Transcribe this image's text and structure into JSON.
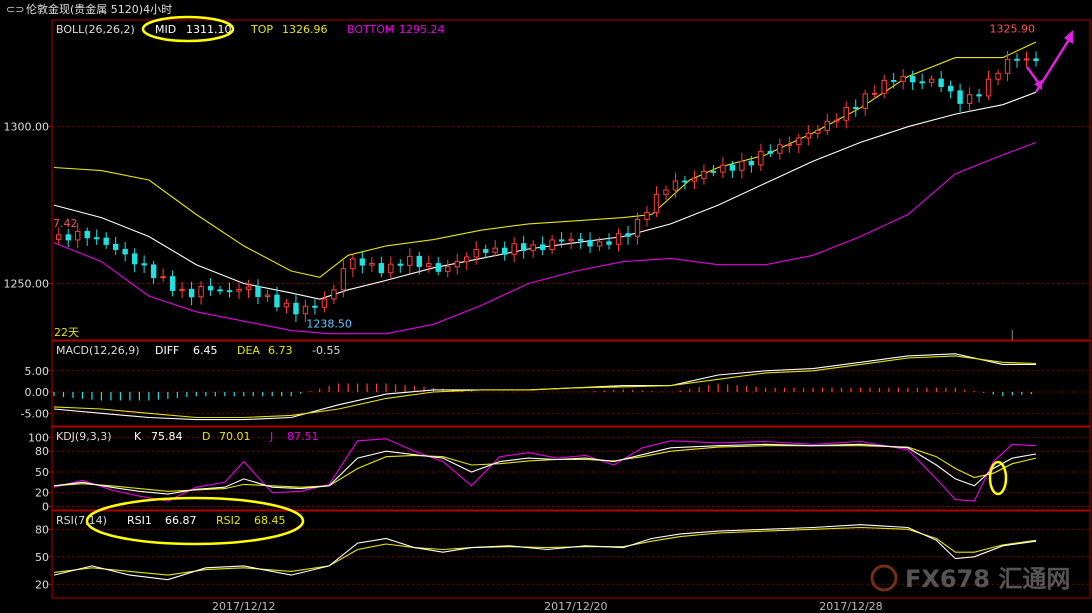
{
  "window": {
    "title": "伦敦金现(贵金属 5120)4小时"
  },
  "chart_data": {
    "type": "candlestick",
    "period": "22天",
    "x_tick_labels": [
      "2017/12/12",
      "2017/12/20",
      "2017/12/28"
    ],
    "price_panel": {
      "indicator": "BOLL(26,26,2)",
      "legend": [
        {
          "label": "MID",
          "value": "1311.10",
          "color": "#ffffff"
        },
        {
          "label": "TOP",
          "value": "1326.96",
          "color": "#e6e600"
        },
        {
          "label": "BOTTOM",
          "value": "1295.24",
          "color": "#e600e6"
        }
      ],
      "y_ticks": [
        "1300.00",
        "1250.00"
      ],
      "y_tick_values": [
        1300,
        1250
      ],
      "ylim": [
        1232,
        1334
      ],
      "annotations": {
        "high": "1325.90",
        "low": "1238.50",
        "left_value": "7.42"
      },
      "close_path": [
        [
          0,
          1264
        ],
        [
          6,
          1266
        ],
        [
          12,
          1262
        ],
        [
          18,
          1256
        ],
        [
          24,
          1250
        ],
        [
          28,
          1246
        ],
        [
          32,
          1249
        ],
        [
          36,
          1247
        ],
        [
          40,
          1249
        ],
        [
          44,
          1246
        ],
        [
          48,
          1243
        ],
        [
          52,
          1241
        ],
        [
          56,
          1244
        ],
        [
          58,
          1245
        ],
        [
          62,
          1258
        ],
        [
          66,
          1256
        ],
        [
          70,
          1254
        ],
        [
          74,
          1258
        ],
        [
          78,
          1256
        ],
        [
          82,
          1254
        ],
        [
          86,
          1258
        ],
        [
          90,
          1261
        ],
        [
          94,
          1260
        ],
        [
          98,
          1262
        ],
        [
          102,
          1261
        ],
        [
          106,
          1264
        ],
        [
          110,
          1264
        ],
        [
          114,
          1262
        ],
        [
          118,
          1264
        ],
        [
          122,
          1267
        ],
        [
          126,
          1276
        ],
        [
          130,
          1282
        ],
        [
          134,
          1283
        ],
        [
          138,
          1286
        ],
        [
          142,
          1287
        ],
        [
          146,
          1288
        ],
        [
          150,
          1292
        ],
        [
          154,
          1294
        ],
        [
          158,
          1297
        ],
        [
          162,
          1300
        ],
        [
          166,
          1304
        ],
        [
          170,
          1308
        ],
        [
          174,
          1313
        ],
        [
          178,
          1316
        ],
        [
          182,
          1314
        ],
        [
          186,
          1315
        ],
        [
          190,
          1309
        ],
        [
          192,
          1308
        ],
        [
          196,
          1312
        ],
        [
          200,
          1320
        ],
        [
          203,
          1322
        ],
        [
          206,
          1321
        ]
      ],
      "mid_path": [
        [
          0,
          1275
        ],
        [
          10,
          1271
        ],
        [
          20,
          1265
        ],
        [
          30,
          1256
        ],
        [
          40,
          1250
        ],
        [
          50,
          1247
        ],
        [
          56,
          1245
        ],
        [
          62,
          1248
        ],
        [
          70,
          1251
        ],
        [
          80,
          1255
        ],
        [
          90,
          1258
        ],
        [
          100,
          1261
        ],
        [
          110,
          1263
        ],
        [
          120,
          1265
        ],
        [
          130,
          1269
        ],
        [
          140,
          1275
        ],
        [
          150,
          1282
        ],
        [
          160,
          1289
        ],
        [
          170,
          1295
        ],
        [
          180,
          1300
        ],
        [
          190,
          1304
        ],
        [
          200,
          1307
        ],
        [
          207,
          1311
        ]
      ],
      "top_path": [
        [
          0,
          1287
        ],
        [
          10,
          1286
        ],
        [
          20,
          1283
        ],
        [
          30,
          1272
        ],
        [
          40,
          1262
        ],
        [
          50,
          1254
        ],
        [
          56,
          1252
        ],
        [
          62,
          1259
        ],
        [
          70,
          1262
        ],
        [
          80,
          1264
        ],
        [
          90,
          1267
        ],
        [
          100,
          1269
        ],
        [
          110,
          1270
        ],
        [
          120,
          1271
        ],
        [
          126,
          1272
        ],
        [
          134,
          1283
        ],
        [
          140,
          1287
        ],
        [
          150,
          1291
        ],
        [
          160,
          1298
        ],
        [
          170,
          1306
        ],
        [
          180,
          1316
        ],
        [
          190,
          1322
        ],
        [
          200,
          1322
        ],
        [
          207,
          1327
        ]
      ],
      "bottom_path": [
        [
          0,
          1263
        ],
        [
          10,
          1257
        ],
        [
          20,
          1246
        ],
        [
          30,
          1241
        ],
        [
          40,
          1238
        ],
        [
          50,
          1235
        ],
        [
          58,
          1234
        ],
        [
          70,
          1234
        ],
        [
          80,
          1237
        ],
        [
          90,
          1243
        ],
        [
          100,
          1250
        ],
        [
          110,
          1254
        ],
        [
          120,
          1257
        ],
        [
          130,
          1258
        ],
        [
          140,
          1256
        ],
        [
          150,
          1256
        ],
        [
          160,
          1259
        ],
        [
          170,
          1265
        ],
        [
          180,
          1272
        ],
        [
          190,
          1285
        ],
        [
          200,
          1291
        ],
        [
          207,
          1295
        ]
      ]
    },
    "macd_panel": {
      "indicator": "MACD(12,26,9)",
      "legend": [
        {
          "label": "DIFF",
          "value": "6.45",
          "color": "#ffffff"
        },
        {
          "label": "DEA",
          "value": "6.73",
          "color": "#e6e600"
        },
        {
          "label": "",
          "value": "-0.55",
          "color": "#dddddd"
        }
      ],
      "y_ticks": [
        "5.00",
        "0.00",
        "-5.00"
      ],
      "y_tick_values": [
        5,
        0,
        -5
      ],
      "ylim": [
        -8,
        12
      ],
      "diff_path": [
        [
          0,
          -4
        ],
        [
          10,
          -5
        ],
        [
          20,
          -6
        ],
        [
          30,
          -6.5
        ],
        [
          40,
          -6.5
        ],
        [
          50,
          -6
        ],
        [
          60,
          -3
        ],
        [
          70,
          -0.5
        ],
        [
          80,
          0.5
        ],
        [
          90,
          0.5
        ],
        [
          100,
          0.5
        ],
        [
          110,
          1
        ],
        [
          120,
          1.5
        ],
        [
          130,
          1.5
        ],
        [
          140,
          4
        ],
        [
          150,
          5
        ],
        [
          160,
          5.5
        ],
        [
          170,
          7
        ],
        [
          180,
          8.5
        ],
        [
          190,
          9
        ],
        [
          200,
          6.5
        ],
        [
          207,
          6.5
        ]
      ],
      "dea_path": [
        [
          0,
          -3.5
        ],
        [
          10,
          -4
        ],
        [
          20,
          -5
        ],
        [
          30,
          -6
        ],
        [
          40,
          -6
        ],
        [
          50,
          -5.5
        ],
        [
          60,
          -4
        ],
        [
          70,
          -1.5
        ],
        [
          80,
          0
        ],
        [
          90,
          0.5
        ],
        [
          100,
          0.5
        ],
        [
          110,
          1
        ],
        [
          120,
          1.2
        ],
        [
          130,
          1.5
        ],
        [
          140,
          3
        ],
        [
          150,
          4.5
        ],
        [
          160,
          5
        ],
        [
          170,
          6.5
        ],
        [
          180,
          8
        ],
        [
          190,
          8.5
        ],
        [
          200,
          7
        ],
        [
          207,
          6.7
        ]
      ]
    },
    "kdj_panel": {
      "indicator": "KDJ(9,3,3)",
      "legend": [
        {
          "label": "K",
          "value": "75.84",
          "color": "#ffffff"
        },
        {
          "label": "D",
          "value": "70.01",
          "color": "#e6e600"
        },
        {
          "label": "J",
          "value": "87.51",
          "color": "#e600e6"
        }
      ],
      "y_ticks": [
        "100",
        "80",
        "50",
        "20",
        "0"
      ],
      "y_tick_values": [
        100,
        80,
        50,
        20,
        0
      ],
      "ylim": [
        -5,
        115
      ],
      "k_path": [
        [
          0,
          30
        ],
        [
          6,
          35
        ],
        [
          12,
          28
        ],
        [
          18,
          22
        ],
        [
          24,
          18
        ],
        [
          30,
          25
        ],
        [
          36,
          28
        ],
        [
          40,
          40
        ],
        [
          46,
          28
        ],
        [
          52,
          26
        ],
        [
          58,
          30
        ],
        [
          64,
          70
        ],
        [
          70,
          80
        ],
        [
          76,
          75
        ],
        [
          82,
          70
        ],
        [
          88,
          50
        ],
        [
          94,
          65
        ],
        [
          100,
          70
        ],
        [
          106,
          68
        ],
        [
          112,
          70
        ],
        [
          118,
          65
        ],
        [
          124,
          75
        ],
        [
          130,
          85
        ],
        [
          140,
          88
        ],
        [
          150,
          90
        ],
        [
          160,
          88
        ],
        [
          170,
          90
        ],
        [
          180,
          85
        ],
        [
          186,
          60
        ],
        [
          190,
          40
        ],
        [
          194,
          30
        ],
        [
          198,
          55
        ],
        [
          202,
          70
        ],
        [
          207,
          76
        ]
      ],
      "d_path": [
        [
          0,
          30
        ],
        [
          6,
          33
        ],
        [
          12,
          30
        ],
        [
          18,
          26
        ],
        [
          24,
          22
        ],
        [
          30,
          24
        ],
        [
          36,
          26
        ],
        [
          40,
          32
        ],
        [
          46,
          30
        ],
        [
          52,
          28
        ],
        [
          58,
          30
        ],
        [
          64,
          55
        ],
        [
          70,
          72
        ],
        [
          76,
          74
        ],
        [
          82,
          72
        ],
        [
          88,
          60
        ],
        [
          94,
          62
        ],
        [
          100,
          66
        ],
        [
          106,
          68
        ],
        [
          112,
          68
        ],
        [
          118,
          66
        ],
        [
          124,
          72
        ],
        [
          130,
          80
        ],
        [
          140,
          86
        ],
        [
          150,
          88
        ],
        [
          160,
          88
        ],
        [
          170,
          88
        ],
        [
          180,
          86
        ],
        [
          186,
          72
        ],
        [
          190,
          55
        ],
        [
          194,
          42
        ],
        [
          198,
          48
        ],
        [
          202,
          62
        ],
        [
          207,
          70
        ]
      ],
      "j_path": [
        [
          0,
          28
        ],
        [
          6,
          38
        ],
        [
          12,
          24
        ],
        [
          18,
          15
        ],
        [
          24,
          8
        ],
        [
          30,
          28
        ],
        [
          36,
          35
        ],
        [
          40,
          65
        ],
        [
          46,
          20
        ],
        [
          52,
          22
        ],
        [
          58,
          32
        ],
        [
          64,
          95
        ],
        [
          70,
          98
        ],
        [
          76,
          80
        ],
        [
          82,
          65
        ],
        [
          88,
          30
        ],
        [
          94,
          72
        ],
        [
          100,
          78
        ],
        [
          106,
          70
        ],
        [
          112,
          74
        ],
        [
          118,
          60
        ],
        [
          124,
          85
        ],
        [
          130,
          95
        ],
        [
          140,
          92
        ],
        [
          150,
          94
        ],
        [
          160,
          90
        ],
        [
          170,
          94
        ],
        [
          180,
          82
        ],
        [
          186,
          40
        ],
        [
          190,
          10
        ],
        [
          194,
          8
        ],
        [
          198,
          65
        ],
        [
          202,
          90
        ],
        [
          207,
          88
        ]
      ]
    },
    "rsi_panel": {
      "indicator": "RSI(7,14)",
      "legend": [
        {
          "label": "RSI1",
          "value": "66.87",
          "color": "#ffffff"
        },
        {
          "label": "RSI2",
          "value": "68.45",
          "color": "#e6e600"
        }
      ],
      "y_ticks": [
        "80",
        "50",
        "20"
      ],
      "y_tick_values": [
        80,
        50,
        20
      ],
      "ylim": [
        5,
        100
      ],
      "rsi1_path": [
        [
          0,
          30
        ],
        [
          8,
          40
        ],
        [
          16,
          30
        ],
        [
          24,
          25
        ],
        [
          32,
          38
        ],
        [
          40,
          40
        ],
        [
          50,
          30
        ],
        [
          58,
          40
        ],
        [
          64,
          65
        ],
        [
          70,
          70
        ],
        [
          76,
          60
        ],
        [
          82,
          55
        ],
        [
          88,
          60
        ],
        [
          96,
          62
        ],
        [
          104,
          58
        ],
        [
          112,
          62
        ],
        [
          120,
          60
        ],
        [
          126,
          70
        ],
        [
          132,
          75
        ],
        [
          140,
          78
        ],
        [
          150,
          80
        ],
        [
          160,
          82
        ],
        [
          170,
          85
        ],
        [
          180,
          82
        ],
        [
          186,
          68
        ],
        [
          190,
          48
        ],
        [
          194,
          50
        ],
        [
          200,
          62
        ],
        [
          207,
          67
        ]
      ],
      "rsi2_path": [
        [
          0,
          33
        ],
        [
          8,
          38
        ],
        [
          16,
          34
        ],
        [
          24,
          30
        ],
        [
          32,
          36
        ],
        [
          40,
          38
        ],
        [
          50,
          34
        ],
        [
          58,
          40
        ],
        [
          64,
          58
        ],
        [
          70,
          64
        ],
        [
          76,
          60
        ],
        [
          82,
          58
        ],
        [
          88,
          60
        ],
        [
          96,
          61
        ],
        [
          104,
          60
        ],
        [
          112,
          61
        ],
        [
          120,
          61
        ],
        [
          126,
          67
        ],
        [
          132,
          72
        ],
        [
          140,
          76
        ],
        [
          150,
          78
        ],
        [
          160,
          80
        ],
        [
          170,
          82
        ],
        [
          180,
          80
        ],
        [
          186,
          70
        ],
        [
          190,
          55
        ],
        [
          194,
          55
        ],
        [
          200,
          63
        ],
        [
          207,
          68
        ]
      ]
    },
    "watermark": "FX678 汇通网"
  }
}
